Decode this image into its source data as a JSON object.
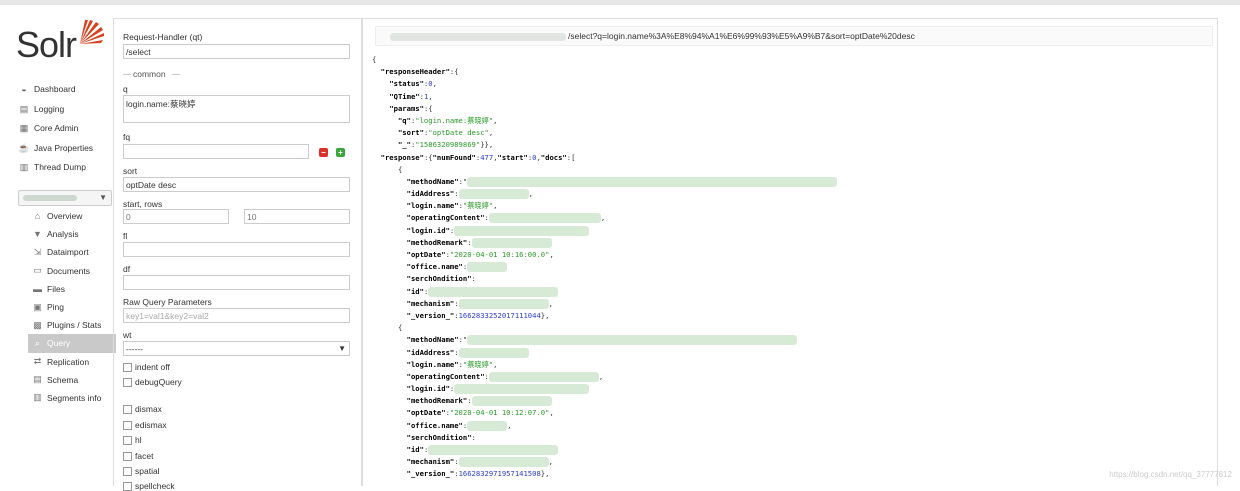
{
  "app": {
    "logo_text": "Solr"
  },
  "nav": [
    {
      "label": "Dashboard",
      "icon": "dashboard-icon"
    },
    {
      "label": "Logging",
      "icon": "logging-icon"
    },
    {
      "label": "Core Admin",
      "icon": "core-admin-icon"
    },
    {
      "label": "Java Properties",
      "icon": "java-icon"
    },
    {
      "label": "Thread Dump",
      "icon": "thread-dump-icon"
    }
  ],
  "core_nav": [
    {
      "label": "Overview",
      "icon": "home-icon"
    },
    {
      "label": "Analysis",
      "icon": "filter-icon"
    },
    {
      "label": "Dataimport",
      "icon": "dataimport-icon"
    },
    {
      "label": "Documents",
      "icon": "documents-icon"
    },
    {
      "label": "Files",
      "icon": "folder-icon"
    },
    {
      "label": "Ping",
      "icon": "ping-icon"
    },
    {
      "label": "Plugins / Stats",
      "icon": "plugins-icon"
    },
    {
      "label": "Query",
      "icon": "search-icon",
      "active": true
    },
    {
      "label": "Replication",
      "icon": "replication-icon"
    },
    {
      "label": "Schema",
      "icon": "schema-icon"
    },
    {
      "label": "Segments info",
      "icon": "segments-icon"
    }
  ],
  "form": {
    "request_handler_label": "Request-Handler (qt)",
    "request_handler_value": "/select",
    "common_legend": "common",
    "q_label": "q",
    "q_value": "login.name:蔡晓婷",
    "fq_label": "fq",
    "fq_value": "",
    "sort_label": "sort",
    "sort_value": "optDate desc",
    "start_rows_label": "start, rows",
    "start_value": "0",
    "rows_value": "10",
    "fl_label": "fl",
    "df_label": "df",
    "raw_label": "Raw Query Parameters",
    "raw_placeholder": "key1=val1&key2=val2",
    "wt_label": "wt",
    "wt_value": "------",
    "indent_label": "indent off",
    "debug_label": "debugQuery",
    "dismax_label": "dismax",
    "edismax_label": "edismax",
    "hl_label": "hl",
    "facet_label": "facet",
    "spatial_label": "spatial",
    "spellcheck_label": "spellcheck"
  },
  "result": {
    "url_suffix": "/select?q=login.name%3A%E8%94%A1%E6%99%93%E5%A9%B7&sort=optDate%20desc",
    "open_brace": "{",
    "rh_key": "\"responseHeader\"",
    "status_key": "\"status\"",
    "status_val": "0",
    "qtime_key": "\"QTime\"",
    "qtime_val": "1",
    "params_key": "\"params\"",
    "pq_key": "\"q\"",
    "pq_val": "\"login.name:蔡晓婷\"",
    "psort_key": "\"sort\"",
    "psort_val": "\"optDate desc\"",
    "pu_key": "\"_\"",
    "pu_val": "\"1586320989869\"",
    "resp_key": "\"response\"",
    "numfound_key": "\"numFound\"",
    "numfound_val": "477",
    "start_key": "\"start\"",
    "start_val": "0",
    "docs_key": "\"docs\"",
    "doc1_date": "\"2020-04-01 10:16:00.0\"",
    "doc1_login": "\"蔡晓婷\"",
    "doc1_version": "1662833252017111044",
    "doc2_date": "\"2020-04-01 10:12:07.0\"",
    "doc2_login": "\"蔡晓婷\"",
    "doc2_version": "1662832971957141508",
    "f_methodName": "\"methodName\"",
    "f_idAddress": "\"idAddress\"",
    "f_loginname": "\"login.name\"",
    "f_operating": "\"operatingContent\"",
    "f_loginid": "\"login.id\"",
    "f_methodRemark": "\"methodRemark\"",
    "f_optDate": "\"optDate\"",
    "f_officename": "\"office.name\"",
    "f_serch": "\"serchOndition\"",
    "f_id": "\"id\"",
    "f_mechanism": "\"mechanism\"",
    "f_version": "\"_version_\""
  },
  "watermark": "https://blog.csdn.net/qq_37777812"
}
